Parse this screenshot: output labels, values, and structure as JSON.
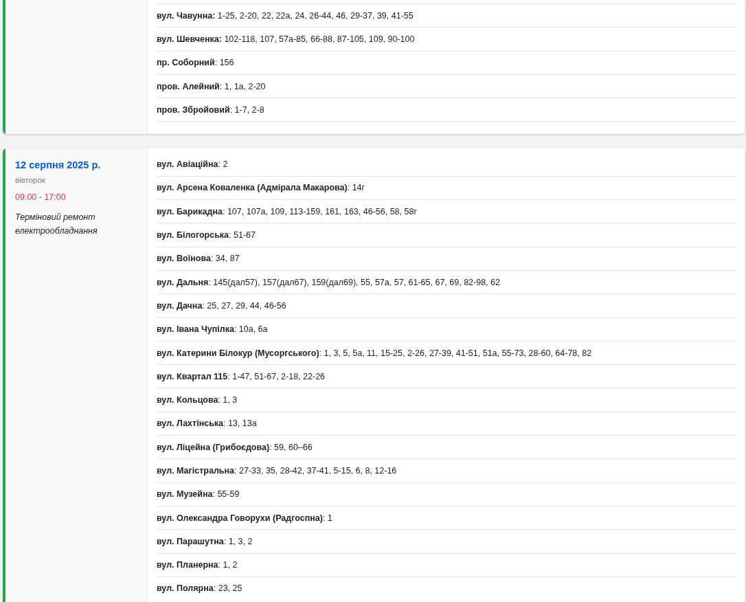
{
  "outages": [
    {
      "streets": [
        "**вул. Чавунна:** 1-25, 2-20, 22, 22а, 24, 26-44, 46, 29-37, 39, 41-55",
        "**вул. Шевченка:** 102-118, 107, 57а-85, 66-88, 87-105, 109, 90-100",
        "**пр. Соборний**: 156",
        "**пров. Алейний**: 1, 1а, 2-20",
        "**пров. Збройовий**: 1-7, 2-8"
      ]
    },
    {
      "date": "12 серпня 2025 р.",
      "weekday": "вівторок",
      "time": "09:00 - 17:00",
      "reason": "Терміновий ремонт електрообладнання",
      "streets": [
        "**вул. Авіаційна**: 2",
        "**вул. Арсена Коваленка (Адмірала Макарова)**: 14г",
        "**вул. Барикадна**: 107, 107а, 109, 113-159, 161, 163, 46-56, 58, 58г",
        "**вул. Білогорська**: 51-67",
        "**вул. Воїнова**: 34, 87",
        "**вул. Дальня**: 145(дал57), 157(дал67), 159(дал69), 55, 57а, 57, 61-65, 67, 69, 82-98, 62",
        "**вул. Дачна**: 25, 27, 29, 44, 46-56",
        "**вул. Івана Чупілка**: 10а, 6а",
        "**вул. Катерини Білокур (Мусоргського)**: 1, 3, 5, 5а, 11, 15-25, 2-26, 27-39, 41-51, 51а, 55-73, 28-60, 64-78, 82",
        "**вул. Квартал 115**: 1-47, 51-67, 2-18, 22-26",
        "**вул. Кольцова**: 1, 3",
        "**вул. Лахтінська**: 13, 13а",
        "**вул. Ліцейна (Грибоєдова)**: 59, 60–66",
        "**вул. Магістральна**: 27-33, 35, 28-42, 37-41, 5-15, 6, 8, 12-16",
        "**вул. Музейна**: 55-59",
        "**вул. Олександра Говорухи (Радгоспна)**: 1",
        "**вул. Парашутна**: 1, 3, 2",
        "**вул. Планерна**: 1, 2",
        "**вул. Полярна**: 23, 25"
      ]
    }
  ]
}
